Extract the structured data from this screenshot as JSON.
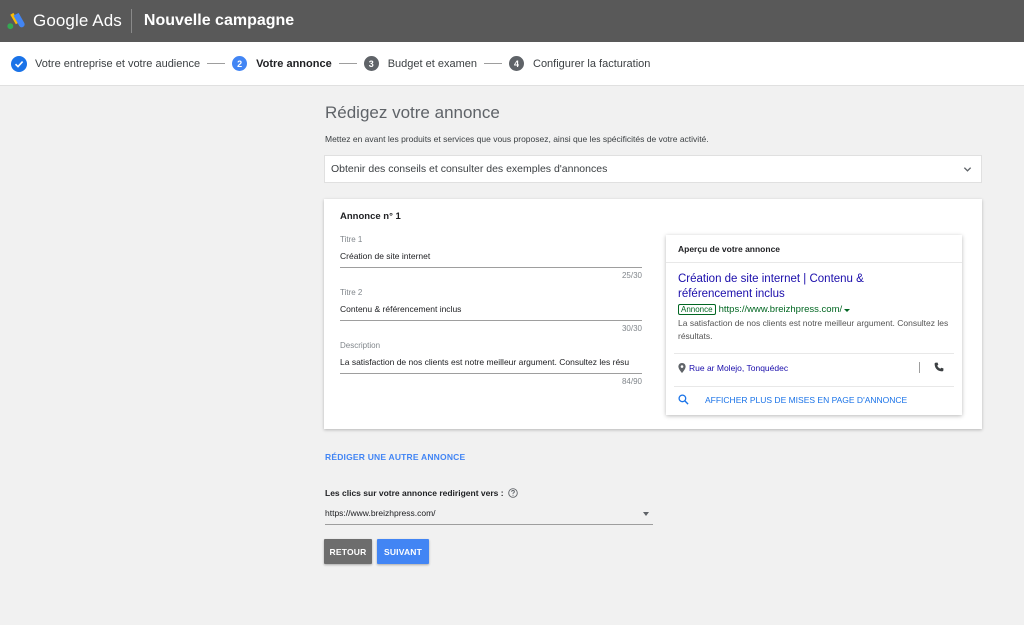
{
  "header": {
    "brand": "Google Ads",
    "page_title": "Nouvelle campagne"
  },
  "stepper": {
    "steps": [
      {
        "label": "Votre entreprise et votre audience",
        "state": "done"
      },
      {
        "number": "2",
        "label": "Votre annonce",
        "state": "active"
      },
      {
        "number": "3",
        "label": "Budget et examen",
        "state": "pending"
      },
      {
        "number": "4",
        "label": "Configurer la facturation",
        "state": "pending"
      }
    ]
  },
  "main": {
    "title": "Rédigez votre annonce",
    "subtitle": "Mettez en avant les produits et services que vous proposez, ainsi que les spécificités de votre activité.",
    "tips_label": "Obtenir des conseils et consulter des exemples d'annonces"
  },
  "ad": {
    "title": "Annonce n° 1",
    "fields": [
      {
        "label": "Titre 1",
        "value": "Création de site internet",
        "count": "25/30"
      },
      {
        "label": "Titre 2",
        "value": "Contenu & référencement inclus",
        "count": "30/30"
      },
      {
        "label": "Description",
        "value": "La satisfaction de nos clients est notre meilleur argument. Consultez les résu",
        "count": "84/90"
      }
    ]
  },
  "preview": {
    "header": "Aperçu de votre annonce",
    "headline_line1": "Création de site internet | Contenu &",
    "headline_line2": "référencement inclus",
    "badge": "Annonce",
    "url": "https://www.breizhpress.com/",
    "description": "La satisfaction de nos clients est notre meilleur argument. Consultez les résultats.",
    "location": "Rue ar Molejo, Tonquédec",
    "more_label": "AFFICHER PLUS DE MISES EN PAGE D'ANNONCE"
  },
  "actions": {
    "write_another": "RÉDIGER UNE AUTRE ANNONCE",
    "redirect_label": "Les clics sur votre annonce redirigent vers :",
    "redirect_value": "https://www.breizhpress.com/",
    "back_label": "RETOUR",
    "next_label": "SUIVANT"
  },
  "colors": {
    "header_bg": "#595959",
    "accent": "#4285f4",
    "link": "#1a0dab",
    "url_green": "#006621"
  },
  "icons": {
    "logo": "google-ads-logo",
    "check": "check-icon",
    "chevron": "chevron-down-icon",
    "pin": "location-pin-icon",
    "phone": "phone-icon",
    "search": "search-icon",
    "help": "help-icon"
  }
}
